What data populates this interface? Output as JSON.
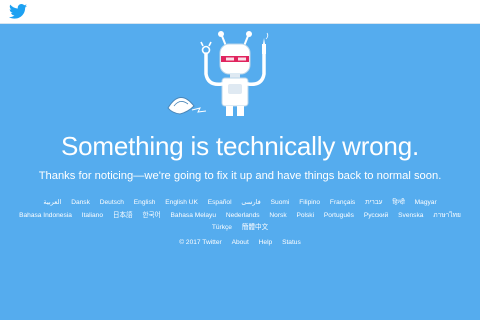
{
  "header": {
    "logo_icon": "twitter-bird-icon",
    "logo_color": "#1da1f2"
  },
  "colors": {
    "background": "#55acee",
    "text": "#ffffff"
  },
  "illustration": {
    "icon": "robot-error-icon",
    "secondary_icon": "broken-fortune-cookie-icon"
  },
  "main": {
    "headline": "Something is technically wrong.",
    "message": "Thanks for noticing—we're going to fix it up and have things back to normal soon."
  },
  "languages": [
    "العربية",
    "Dansk",
    "Deutsch",
    "English",
    "English UK",
    "Español",
    "فارسی",
    "Suomi",
    "Filipino",
    "Français",
    "עברית",
    "हिन्दी",
    "Magyar",
    "Bahasa Indonesia",
    "Italiano",
    "日本語",
    "한국어",
    "Bahasa Melayu",
    "Nederlands",
    "Norsk",
    "Polski",
    "Português",
    "Русский",
    "Svenska",
    "ภาษาไทย",
    "Türkçe",
    "簡體中文"
  ],
  "footer": {
    "copyright": "© 2017 Twitter",
    "links": [
      "About",
      "Help",
      "Status"
    ]
  }
}
